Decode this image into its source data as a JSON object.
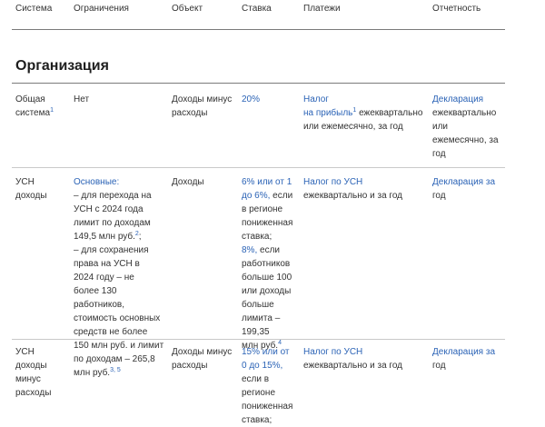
{
  "header": {
    "col_system": "Система",
    "col_limits": "Ограничения",
    "col_object": "Объект",
    "col_rate": "Ставка",
    "col_payments": "Платежи",
    "col_reporting": "Отчетность"
  },
  "section_title": "Организация",
  "rows": [
    {
      "system_line1": "Общая",
      "system_line2": "система",
      "system_sup": "1",
      "limits": "Нет",
      "object_line1": "Доходы минус",
      "object_line2": "расходы",
      "rate": "20%",
      "pay_link1": "Налог",
      "pay_link2": "на прибыль",
      "pay_sup": "1",
      "pay_text1": " ежеквартально",
      "pay_text2": "или ежемесячно, за год",
      "rep_link": "Декларация",
      "rep_text1": "ежеквартально",
      "rep_text2": "или",
      "rep_text3": "ежемесячно, за",
      "rep_text4": "год"
    },
    {
      "system_line1": "УСН",
      "system_line2": "доходы",
      "limits_link": "Основные:",
      "limits_l2": "– для перехода на",
      "limits_l3": "УСН с 2024 года",
      "limits_l4": "лимит по доходам",
      "limits_l5": "149,5 млн руб.",
      "limits_sup5": "2",
      "limits_l5_tail": ";",
      "limits_l6": "– для сохранения",
      "limits_l7": "права на УСН в",
      "limits_l8": "2024 году – не",
      "limits_l9": "более 130",
      "limits_l10": "работников,",
      "limits_l11": "стоимость основных",
      "limits_l12": "средств не более",
      "limits_l13": "150 млн руб. и лимит",
      "limits_l14": "по доходам – 265,8",
      "limits_l15": "млн руб.",
      "limits_sup15": "3, 5",
      "object_line1": "Доходы",
      "rate_link1": "6% или от 1",
      "rate_link2": "до 6%,",
      "rate_l2_tail": " если",
      "rate_l3": "в регионе",
      "rate_l4": "пониженная",
      "rate_l5": "ставка;",
      "rate_link6": "8%,",
      "rate_l6_tail": " если",
      "rate_l7": "работников",
      "rate_l8": "больше 100",
      "rate_l9": "или доходы",
      "rate_l10": "больше",
      "rate_l11": "лимита –",
      "rate_l12": "199,35",
      "rate_l13": "млн руб.",
      "rate_sup13": "4",
      "pay_link1": "Налог по УСН",
      "pay_text1": "ежеквартально и за год",
      "rep_link": "Декларация",
      "rep_link_tail": " за",
      "rep_text2": "год"
    },
    {
      "system_line1": "УСН",
      "system_line2": "доходы",
      "system_line3": "минус",
      "system_line4": "расходы",
      "object_line1": "Доходы минус",
      "object_line2": "расходы",
      "rate_link1": "15% или от",
      "rate_link2": "0 до 15%,",
      "rate_l3": "если в",
      "rate_l4": "регионе",
      "rate_l5": "пониженная",
      "rate_l6": "ставка;",
      "pay_link1": "Налог по УСН",
      "pay_text1": "ежеквартально и за год",
      "rep_link": "Декларация",
      "rep_link_tail": " за",
      "rep_text2": "год"
    }
  ]
}
